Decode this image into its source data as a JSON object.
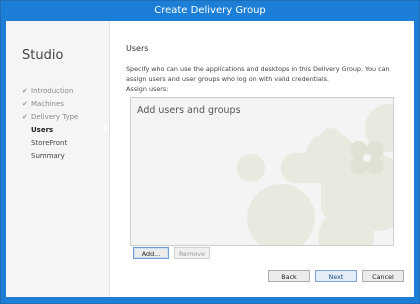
{
  "window": {
    "title": "Create Delivery Group"
  },
  "sidebar": {
    "brand": "Studio",
    "items": [
      {
        "label": "Introduction",
        "state": "done"
      },
      {
        "label": "Machines",
        "state": "done"
      },
      {
        "label": "Delivery Type",
        "state": "done"
      },
      {
        "label": "Users",
        "state": "active"
      },
      {
        "label": "StoreFront",
        "state": "pending"
      },
      {
        "label": "Summary",
        "state": "pending"
      }
    ]
  },
  "page": {
    "heading": "Users",
    "description": "Specify who can use the applications and desktops in this Delivery Group. You can assign users and user groups who log on with valid credentials.",
    "assign_label": "Assign users:",
    "list_placeholder": "Add users and groups"
  },
  "buttons": {
    "add": "Add...",
    "remove": "Remove",
    "back": "Back",
    "next": "Next",
    "cancel": "Cancel"
  },
  "colors": {
    "titlebar": "#1c7ed6",
    "sidebar": "#f5f5f5",
    "accent": "#1a4f8a"
  }
}
